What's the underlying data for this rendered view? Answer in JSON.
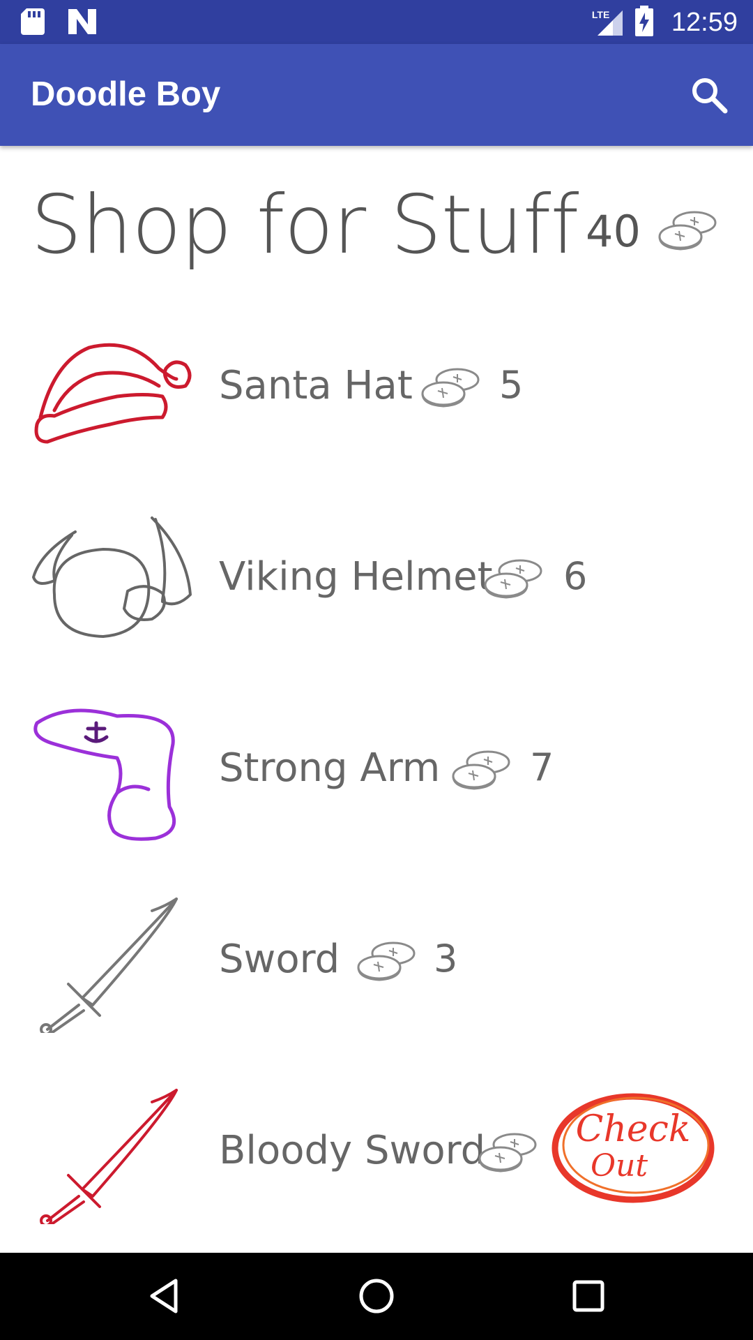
{
  "status_bar": {
    "time": "12:59",
    "network_label": "LTE",
    "icons": [
      "sd-card-icon",
      "notification-n-icon",
      "lte-signal-icon",
      "battery-charging-icon"
    ]
  },
  "app_bar": {
    "title": "Doodle Boy",
    "search_icon": "search-icon"
  },
  "shop": {
    "title": "Shop for Stuff",
    "coin_balance": "40",
    "coin_icon": "coin-icon",
    "items": [
      {
        "name": "Santa Hat",
        "price": "5",
        "icon": "santa-hat-icon",
        "color": "#CC1A2E"
      },
      {
        "name": "Viking Helmet",
        "price": "6",
        "icon": "viking-helmet-icon",
        "color": "#666666"
      },
      {
        "name": "Strong Arm",
        "price": "7",
        "icon": "strong-arm-icon",
        "color": "#9B30D9"
      },
      {
        "name": "Sword",
        "price": "3",
        "icon": "sword-icon",
        "color": "#777777"
      },
      {
        "name": "Bloody Sword",
        "price": "",
        "icon": "bloody-sword-icon",
        "color": "#CC1A2E"
      }
    ]
  },
  "checkout": {
    "line1": "Check",
    "line2": "Out",
    "color": "#E8372A"
  },
  "nav_bar": {
    "buttons": [
      "back-icon",
      "home-icon",
      "recents-icon"
    ]
  },
  "colors": {
    "status_bar": "#303F9F",
    "app_bar": "#3F51B5",
    "text_gray": "#555555"
  }
}
